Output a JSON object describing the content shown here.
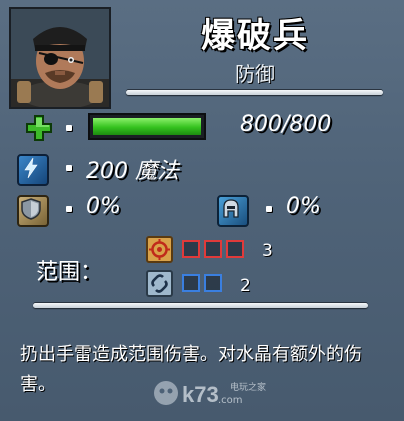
{
  "unit": {
    "name": "爆破兵",
    "role": "防御"
  },
  "stats": {
    "health": {
      "text": "800/800",
      "fill_fraction": 1.0
    },
    "magic": {
      "text": "200 魔法"
    },
    "armor": {
      "text": "0%"
    },
    "magic_resist": {
      "text": "0%"
    }
  },
  "range": {
    "label": "范围：",
    "rows": [
      {
        "icon": "crosshair-icon",
        "filled": 3,
        "count": "3",
        "color": "#e03a3a"
      },
      {
        "icon": "link-icon",
        "filled": 2,
        "count": "2",
        "color": "#3a7fe0"
      }
    ]
  },
  "description": "扔出手雷造成范围伤害。对水晶有额外的伤害。",
  "watermark": {
    "text": "k73",
    "subtext": "电玩之家",
    "domain": ".com"
  },
  "colors": {
    "background": "#4f6378",
    "health": "#34c21e",
    "range_red": "#e03a3a",
    "range_blue": "#3a7fe0"
  }
}
